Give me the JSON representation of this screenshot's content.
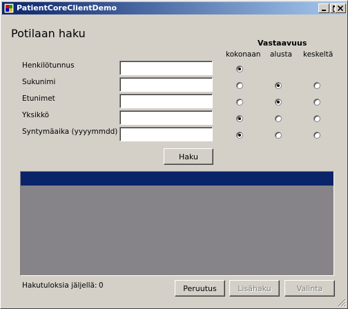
{
  "window": {
    "title": "PatientCoreClientDemo",
    "accent_color": "#0a246a",
    "icons": [
      "app-icon",
      "minimize-icon",
      "maximize-icon",
      "close-icon"
    ]
  },
  "form": {
    "title": "Potilaan haku",
    "fields": [
      {
        "label": "Henkilötunnus",
        "value": ""
      },
      {
        "label": "Sukunimi",
        "value": ""
      },
      {
        "label": "Etunimet",
        "value": ""
      },
      {
        "label": "Yksikkö",
        "value": ""
      },
      {
        "label": "Syntymäaika (yyyymmdd)",
        "value": ""
      }
    ],
    "match_header": "Vastaavuus",
    "match_columns": [
      "kokonaan",
      "alusta",
      "keskeltä"
    ],
    "match_selection": [
      "kokonaan",
      "alusta",
      "alusta",
      "kokonaan",
      "kokonaan"
    ],
    "search_button": "Haku"
  },
  "results": {
    "label": "Hakutuloksia jäljellä:",
    "count": "0"
  },
  "buttons": {
    "cancel": "Peruutus",
    "more": "Lisähaku",
    "select": "Valinta"
  }
}
